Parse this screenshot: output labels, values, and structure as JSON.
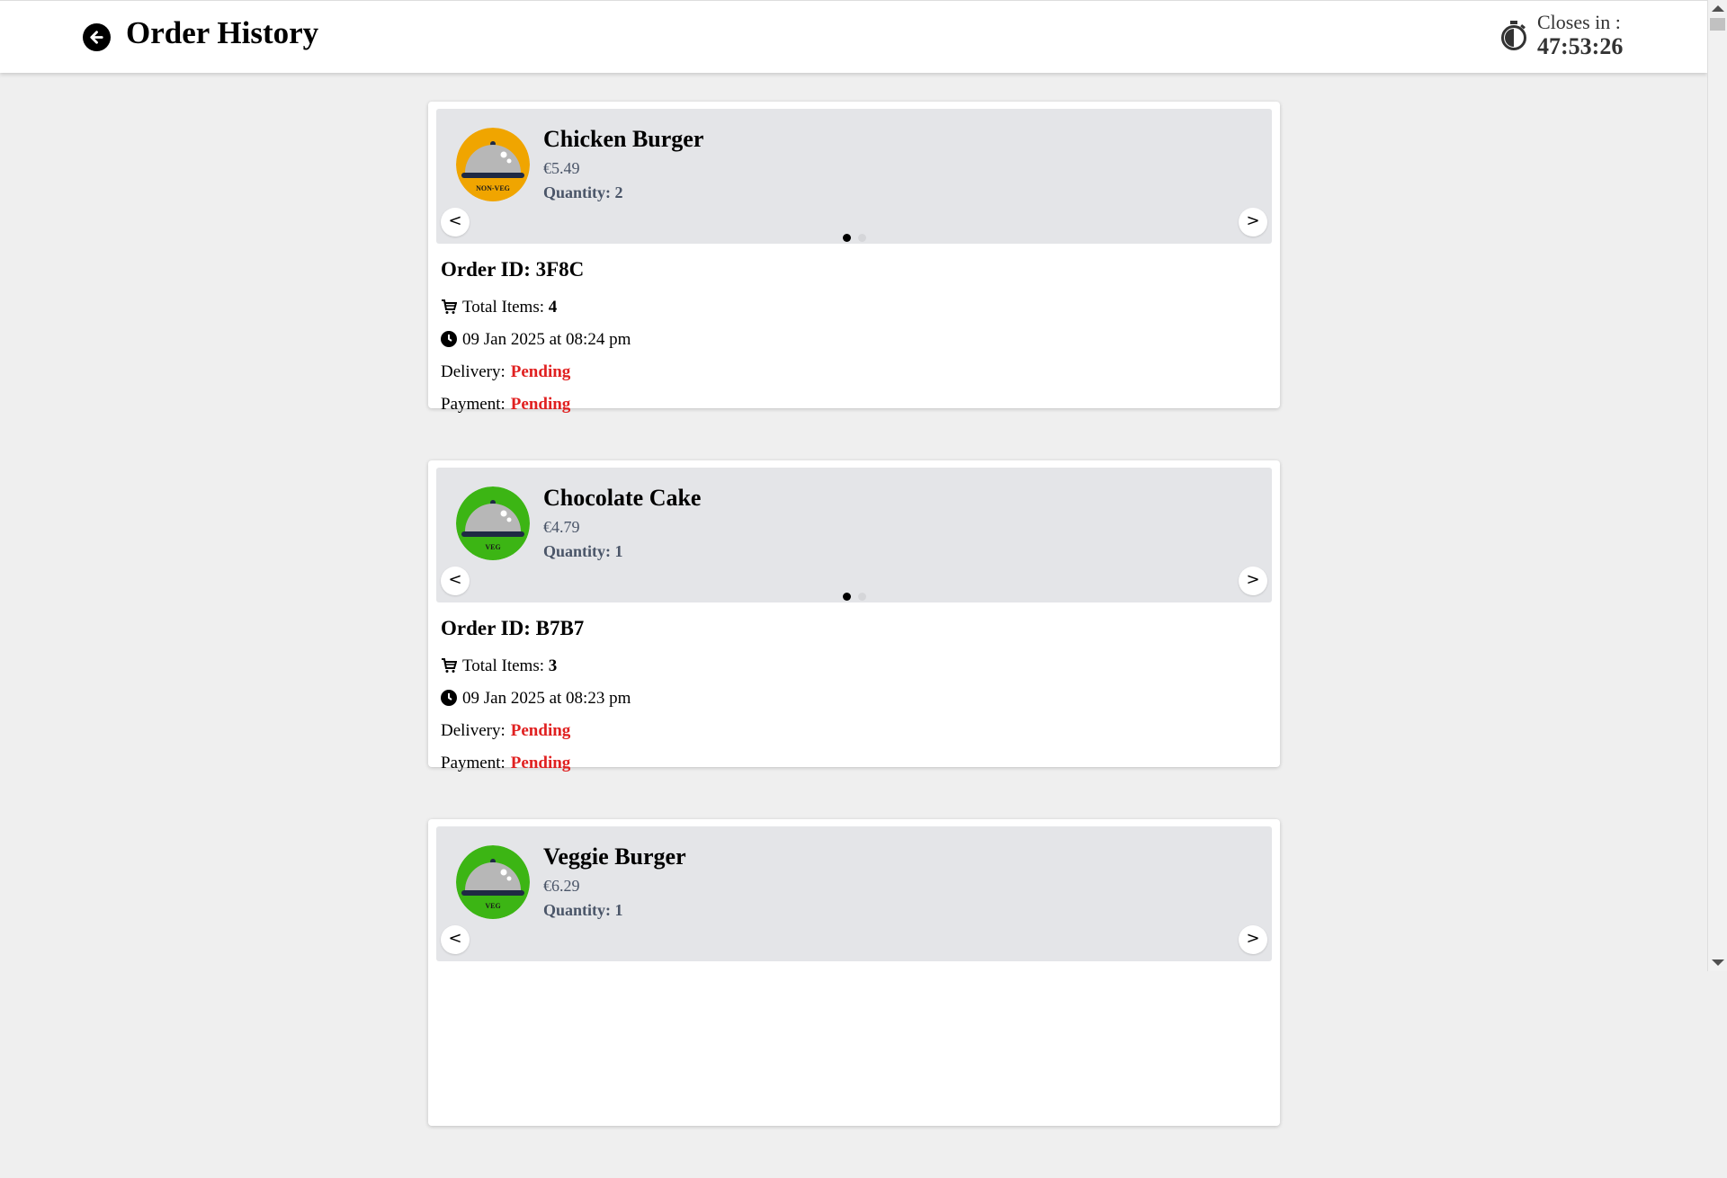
{
  "header": {
    "title": "Order History",
    "timer_label": "Closes in :",
    "timer_value": "47:53:26"
  },
  "labels": {
    "order_id_prefix": "Order ID: ",
    "total_items": "Total Items: ",
    "delivery": "Delivery:",
    "payment": "Payment:",
    "prev": "<",
    "next": ">"
  },
  "colors": {
    "non_veg": "#f0a500",
    "veg": "#3cb514",
    "status_pending": "#e02020"
  },
  "orders": [
    {
      "item_name": "Chicken Burger",
      "price": "€5.49",
      "quantity": "Quantity: 2",
      "badge": "NON-VEG",
      "order_id": "3F8C",
      "total_items": "4",
      "datetime": "09 Jan 2025 at 08:24 pm",
      "delivery": "Pending",
      "payment": "Pending"
    },
    {
      "item_name": "Chocolate Cake",
      "price": "€4.79",
      "quantity": "Quantity: 1",
      "badge": "VEG",
      "order_id": "B7B7",
      "total_items": "3",
      "datetime": "09 Jan 2025 at 08:23 pm",
      "delivery": "Pending",
      "payment": "Pending"
    },
    {
      "item_name": "Veggie Burger",
      "price": "€6.29",
      "quantity": "Quantity: 1",
      "badge": "VEG",
      "order_id": "",
      "total_items": "",
      "datetime": "",
      "delivery": "",
      "payment": ""
    }
  ]
}
